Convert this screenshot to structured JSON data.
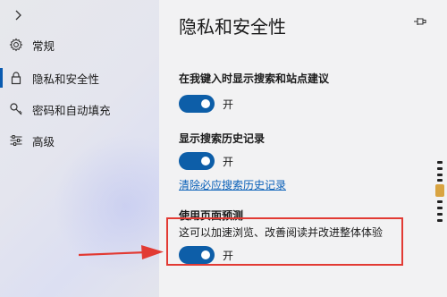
{
  "sidebar": {
    "collapse_icon": "chevron-right-icon",
    "items": [
      {
        "label": "常规",
        "icon": "gear-icon",
        "active": false
      },
      {
        "label": "隐私和安全性",
        "icon": "lock-icon",
        "active": true
      },
      {
        "label": "密码和自动填充",
        "icon": "key-icon",
        "active": false
      },
      {
        "label": "高级",
        "icon": "sliders-icon",
        "active": false
      }
    ],
    "accent_color": "#0a5bb0"
  },
  "panel": {
    "title": "隐私和安全性",
    "pin_icon": "pin-icon",
    "sections": [
      {
        "title": "在我键入时显示搜索和站点建议",
        "toggle_state": "开"
      },
      {
        "title": "显示搜索历史记录",
        "toggle_state": "开",
        "link": "清除必应搜索历史记录"
      },
      {
        "title": "使用页面预测",
        "description": "这可以加速浏览、改善阅读并改进整体体验",
        "toggle_state": "开"
      }
    ]
  },
  "colors": {
    "toggle_on": "#0d5ea8",
    "link": "#0a60b8",
    "annotation": "#e23a33"
  }
}
